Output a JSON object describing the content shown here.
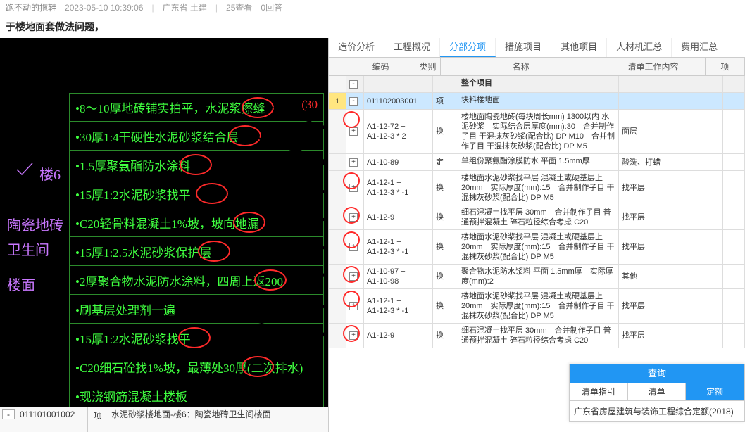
{
  "topbar": {
    "author": "跑不动的拖鞋",
    "time": "2023-05-10 10:39:06",
    "loc": "广东省 土建",
    "views": "25查看",
    "replies": "0回答"
  },
  "title": "于楼地面套做法问题，",
  "cad_side": {
    "floor": "楼6",
    "l2": "陶瓷地砖",
    "l3": "卫生间",
    "l4": "楼面"
  },
  "cad_rows": [
    {
      "t": "•8～10厚地砖铺实拍平，水泥浆擦缝",
      "num": "(30",
      "c": 290
    },
    {
      "t": "•30厚1:4干硬性水泥砂浆结合层",
      "c": 272
    },
    {
      "t": "•1.5厚聚氨酯防水涂料",
      "c": 202
    },
    {
      "t": "•15厚1:2水泥砂浆找平",
      "c": 225
    },
    {
      "t": "•C20轻骨料混凝土1%坡，坡向地漏",
      "c": 278
    },
    {
      "t": "•15厚1:2.5水泥砂浆保护层",
      "c": 228
    },
    {
      "t": "•2厚聚合物水泥防水涂料，四周上返200",
      "c": 308
    },
    {
      "t": "•刷基层处理剂一遍"
    },
    {
      "t": "•15厚1:2水泥砂浆找平",
      "c": 200
    },
    {
      "t": "•C20细石砼找1%坡，最薄处30厚(二次排水)",
      "c": 290
    },
    {
      "t": "•现浇钢筋混凝土楼板"
    }
  ],
  "left_bottom": {
    "code": "011101001002",
    "type": "项",
    "name": "水泥砂浆楼地面-楼6：陶瓷地砖卫生间楼面"
  },
  "tabs": [
    "造价分析",
    "工程概况",
    "分部分项",
    "措施项目",
    "其他项目",
    "人材机汇总",
    "费用汇总"
  ],
  "active_tab": 2,
  "grid_head": {
    "code": "编码",
    "type": "类别",
    "name": "名称",
    "work": "清单工作内容",
    "item": "项"
  },
  "rows": [
    {
      "kind": "hdr",
      "name": "整个项目"
    },
    {
      "kind": "sel",
      "num": "1",
      "code": "011102003001",
      "type": "项",
      "name": "块料楼地面"
    },
    {
      "code": "A1-12-72 +\nA1-12-3 * 2",
      "type": "换",
      "name": "楼地面陶瓷地砖(每块周长mm) 1300以内 水泥砂浆　实际结合层厚度(mm):30　合并制作子目 干混抹灰砂浆(配合比) DP M10　合并制作子目 干混抹灰砂浆(配合比) DP M5",
      "work": "面层",
      "ring": true
    },
    {
      "code": "A1-10-89",
      "type": "定",
      "name": "单组份聚氨酯涂膜防水 平面 1.5mm厚",
      "work": "酸洗、打蜡"
    },
    {
      "code": "A1-12-1 +\nA1-12-3 * -1",
      "type": "换",
      "name": "楼地面水泥砂浆找平层 混凝土或硬基层上 20mm　实际厚度(mm):15　合并制作子目 干混抹灰砂浆(配合比) DP M5",
      "work": "找平层",
      "ring": true
    },
    {
      "code": "A1-12-9",
      "type": "换",
      "name": "细石混凝土找平层 30mm　合并制作子目 普通预拌混凝土 碎石粒径综合考虑 C20",
      "work": "找平层",
      "ring": true
    },
    {
      "code": "A1-12-1 +\nA1-12-3 * -1",
      "type": "换",
      "name": "楼地面水泥砂浆找平层 混凝土或硬基层上 20mm　实际厚度(mm):15　合并制作子目 干混抹灰砂浆(配合比) DP M5",
      "work": "找平层",
      "ring": true
    },
    {
      "code": "A1-10-97 +\nA1-10-98",
      "type": "换",
      "name": "聚合物水泥防水浆料 平面 1.5mm厚　实际厚度(mm):2",
      "work": "其他",
      "ring": true
    },
    {
      "code": "A1-12-1 +\nA1-12-3 * -1",
      "type": "换",
      "name": "楼地面水泥砂浆找平层 混凝土或硬基层上 20mm　实际厚度(mm):15　合并制作子目 干混抹灰砂浆(配合比) DP M5",
      "work": "找平层",
      "ring": true
    },
    {
      "code": "A1-12-9",
      "type": "换",
      "name": "细石混凝土找平层 30mm　合并制作子目 普通预拌混凝土 碎石粒径综合考虑 C20",
      "work": "找平层",
      "ring": true
    }
  ],
  "query": {
    "title": "查询",
    "tabs": [
      "清单指引",
      "清单",
      "定额"
    ],
    "active": 2,
    "body": "广东省房屋建筑与装饰工程综合定额(2018)"
  }
}
